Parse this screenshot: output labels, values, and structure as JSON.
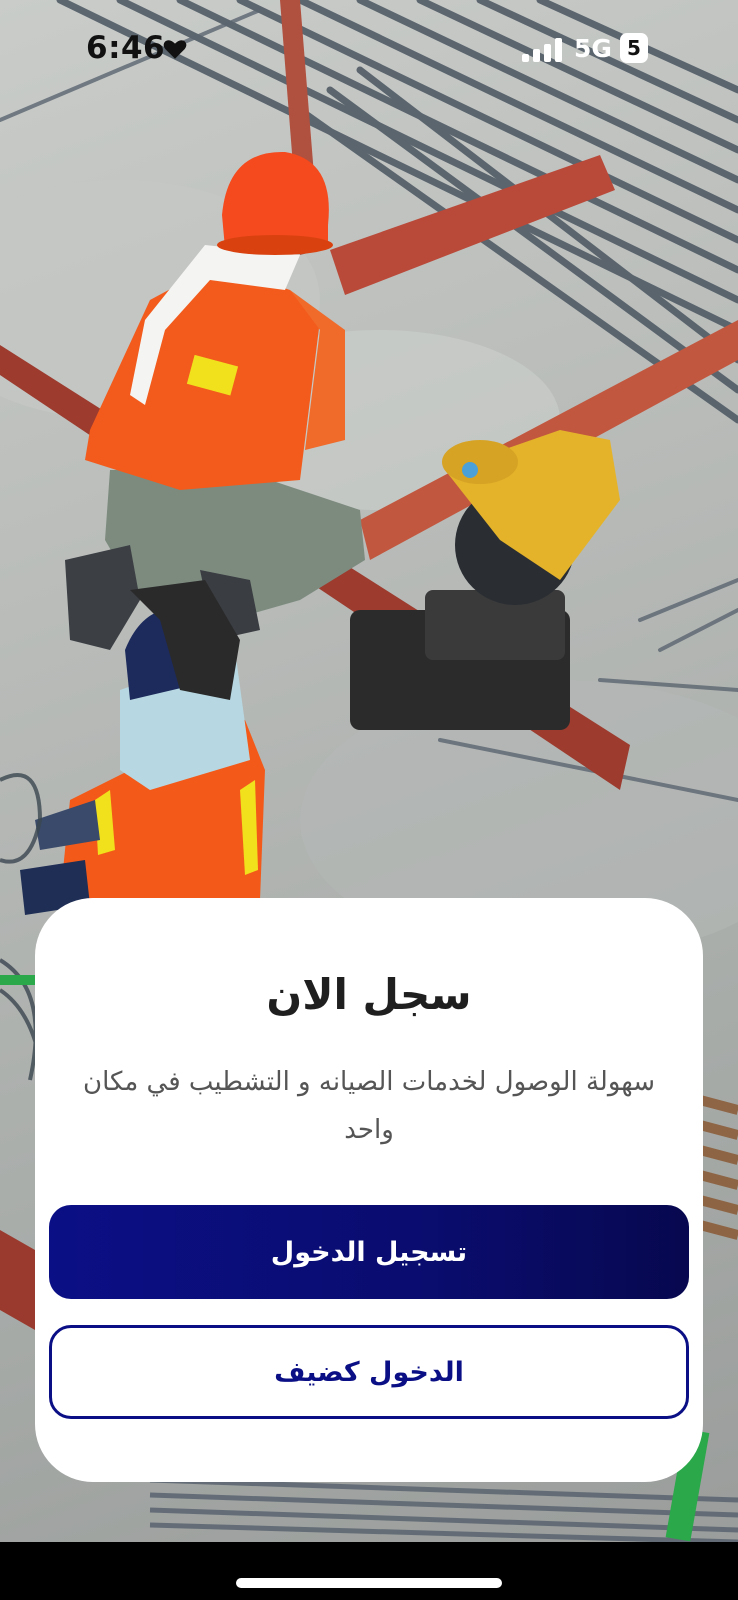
{
  "status_bar": {
    "time": "6:46",
    "network": "5G",
    "battery": "5"
  },
  "card": {
    "title": "سجل الان",
    "subtitle": "سهولة الوصول لخدمات الصيانه و التشطيب في مكان واحد",
    "login_button": "تسجيل الدخول",
    "guest_button": "الدخول كضيف"
  },
  "colors": {
    "primary": "#0b0f85",
    "card_background": "#ffffff"
  },
  "icons": {
    "heart": "heart-icon",
    "signal": "signal-bars-icon",
    "battery": "battery-icon"
  }
}
